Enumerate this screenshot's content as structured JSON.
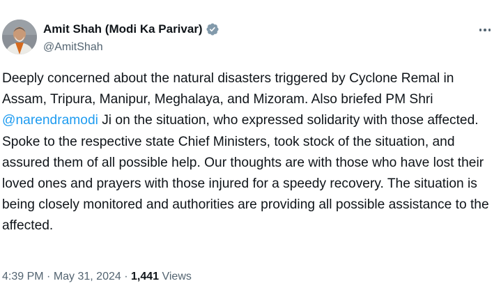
{
  "author": {
    "display_name": "Amit Shah (Modi Ka Parivar)",
    "handle": "@AmitShah",
    "verified_icon": "verified-badge-icon",
    "verified_color": "#829aab"
  },
  "tweet": {
    "text_before_mention": "Deeply concerned about the natural disasters triggered by Cyclone Remal in Assam, Tripura, Manipur, Meghalaya, and Mizoram. Also briefed PM Shri ",
    "mention": "@narendramodi",
    "text_after_mention": " Ji on the situation, who expressed solidarity with those affected. Spoke to the respective state Chief Ministers, took stock of the situation, and assured them of all possible help. Our thoughts are with those who have lost their loved ones and prayers with those injured for a speedy recovery. The situation is being closely monitored and authorities are providing all possible assistance to the affected."
  },
  "meta": {
    "time": "4:39 PM",
    "separator": " · ",
    "date": "May 31, 2024",
    "views_count": "1,441",
    "views_label": " Views"
  },
  "colors": {
    "link": "#1d9bf0",
    "secondary_text": "#536471",
    "primary_text": "#0f1419"
  }
}
